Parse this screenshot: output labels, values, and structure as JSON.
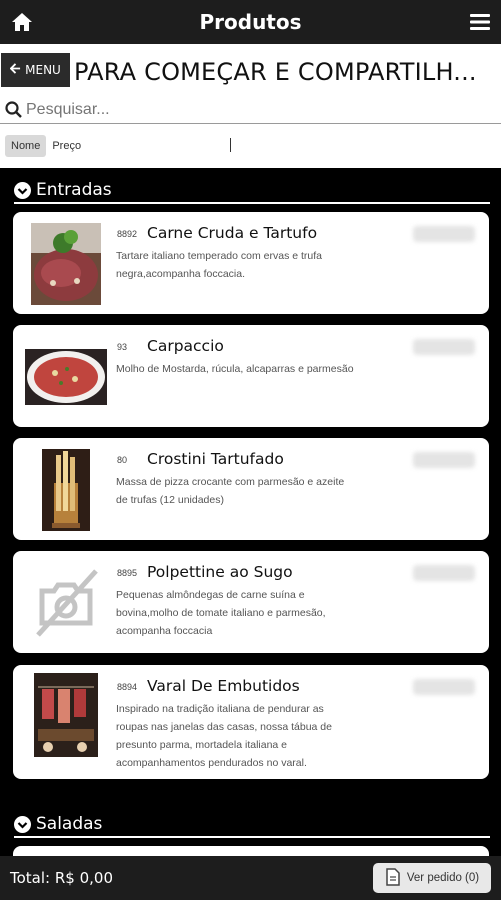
{
  "header": {
    "title": "Produtos"
  },
  "toolbar": {
    "menu_label": "MENU",
    "page_heading": "PARA COMEÇAR E COMPARTILH..."
  },
  "search": {
    "placeholder": "Pesquisar..."
  },
  "sort": {
    "nome_label": "Nome",
    "preco_label": "Preço"
  },
  "sections": [
    {
      "label": "Entradas"
    },
    {
      "label": "Saladas"
    }
  ],
  "products": [
    {
      "code": "8892",
      "name": "Carne Cruda e Tartufo",
      "desc": "Tartare italiano temperado com ervas e trufa negra,acompanha foccacia."
    },
    {
      "code": "93",
      "name": "Carpaccio",
      "desc": "Molho de Mostarda, rúcula, alcaparras e parmesão"
    },
    {
      "code": "80",
      "name": "Crostini Tartufado",
      "desc": "Massa de pizza crocante com parmesão e azeite de trufas (12 unidades)"
    },
    {
      "code": "8895",
      "name": "Polpettine ao Sugo",
      "desc": "Pequenas almôndegas de carne suína e bovina,molho de tomate italiano e parmesão, acompanha foccacia"
    },
    {
      "code": "8894",
      "name": "Varal De Embutidos",
      "desc": "Inspirado na tradição italiana de pendurar as roupas nas janelas das casas, nossa tábua de presunto parma, mortadela italiana e acompanhamentos pendurados no varal."
    }
  ],
  "footer": {
    "total": "Total: R$ 0,00",
    "order_label": "Ver pedido (0)"
  }
}
